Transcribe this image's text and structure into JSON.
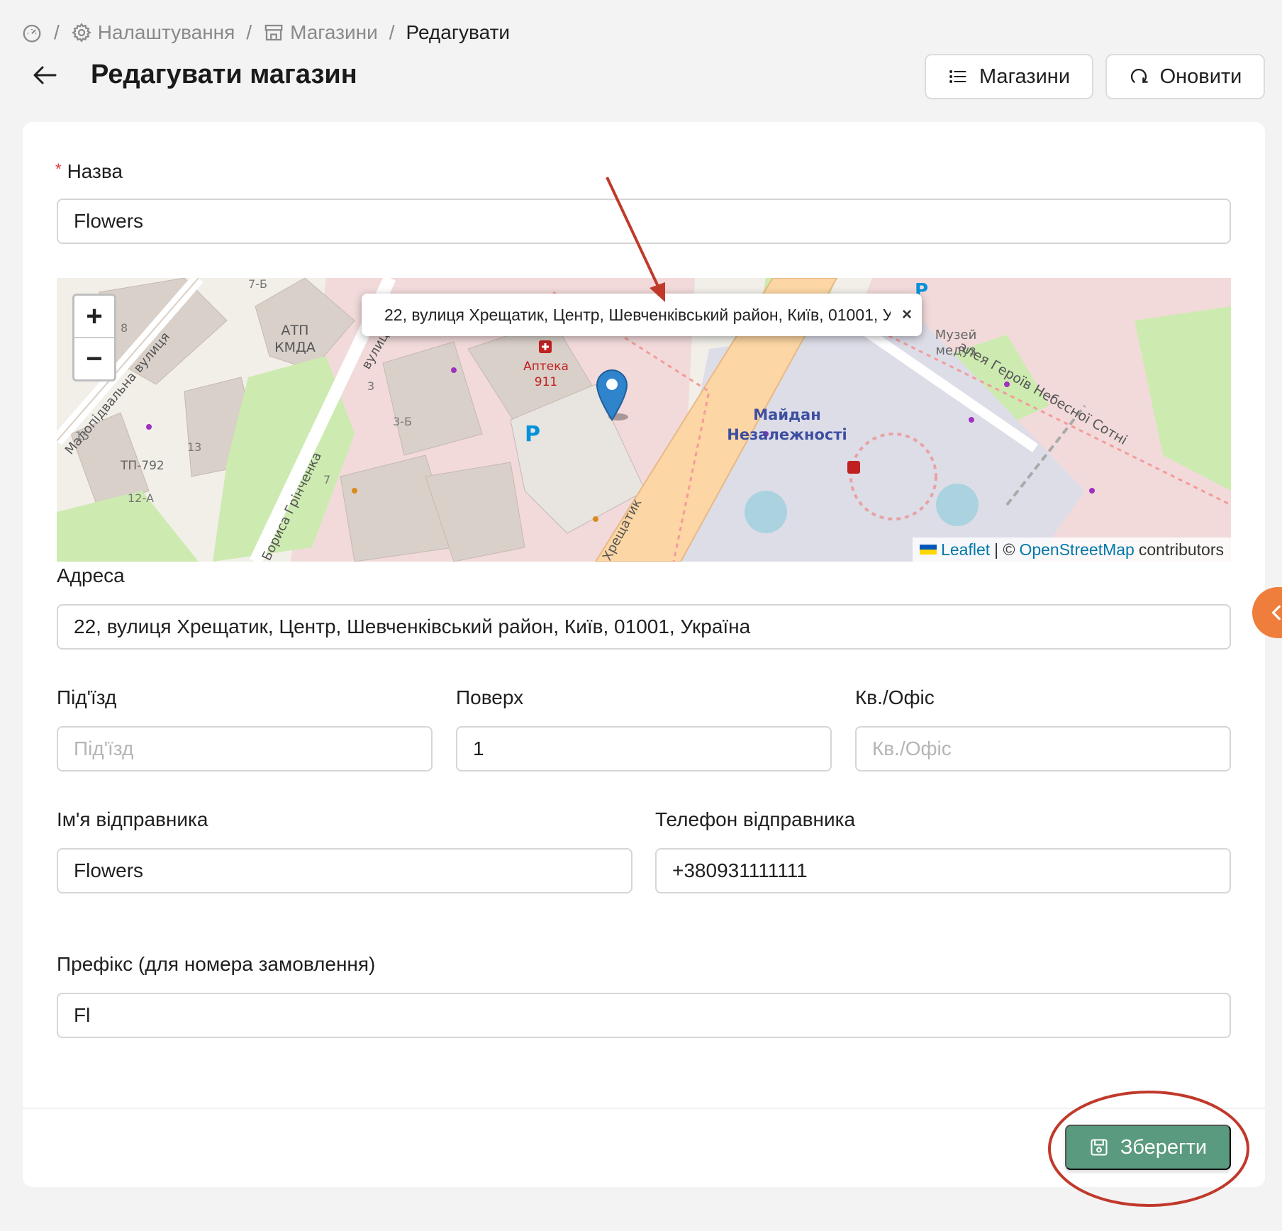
{
  "breadcrumb": {
    "settings": "Налаштування",
    "stores": "Магазини",
    "current": "Редагувати",
    "separator": "/"
  },
  "header": {
    "title": "Редагувати магазин",
    "stores_button": "Магазини",
    "refresh_button": "Оновити"
  },
  "form": {
    "name": {
      "label": "Назва",
      "value": "Flowers",
      "required_mark": "*"
    },
    "address": {
      "label": "Адреса",
      "value": "22, вулиця Хрещатик, Центр, Шевченківський район, Київ, 01001, Україна"
    },
    "entrance": {
      "label": "Під'їзд",
      "value": "",
      "placeholder": "Під'їзд"
    },
    "floor": {
      "label": "Поверх",
      "value": "1",
      "placeholder": "Поверх"
    },
    "apartment": {
      "label": "Кв./Офіс",
      "value": "",
      "placeholder": "Кв./Офіс"
    },
    "sender_name": {
      "label": "Ім'я відправника",
      "value": "Flowers"
    },
    "sender_phone": {
      "label": "Телефон відправника",
      "value": "+380931111111"
    },
    "prefix": {
      "label": "Префікс (для номера замовлення)",
      "value": "Fl"
    }
  },
  "map": {
    "zoom_in": "+",
    "zoom_out": "−",
    "popup_text": "22, вулиця Хрещатик, Центр, Шевченківський район, Київ, 01001, Україна",
    "popup_close": "×",
    "attribution_leaflet": "Leaflet",
    "attribution_sep": "| ©",
    "attribution_osm": "OpenStreetMap",
    "attribution_contrib": "contributors",
    "labels": {
      "street_malopidvalna": "Малопідвальна вулиця",
      "street_hreschatyk": "Хрещатик",
      "street_hrinchenka": "Бориса Грінченка",
      "alley": "алея Героїв Небесної Сотні",
      "maidan_1": "Майдан",
      "maidan_2": "Незалежності",
      "museum_1": "Музей",
      "museum_2": "медуз",
      "apteka_1": "Аптека",
      "apteka_2": "911",
      "atp_1": "АТП",
      "atp_2": "КМДА",
      "tp": "ТП-792",
      "n8": "8",
      "n15": "15",
      "n13": "13",
      "n12a": "12-А",
      "n3": "3",
      "n3b": "3-Б",
      "n7": "7",
      "n7b": "7-Б",
      "parking": "P",
      "street_vul": "вулиця"
    }
  },
  "footer": {
    "save_button": "Зберегти"
  },
  "colors": {
    "accent_green": "#5a9a7e",
    "annotation_red": "#c0392b",
    "side_tab_orange": "#ef7d3c",
    "map_link": "#0078a8"
  }
}
